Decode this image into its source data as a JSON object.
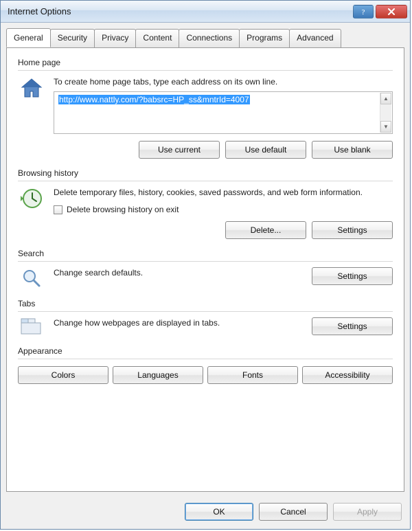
{
  "window": {
    "title": "Internet Options"
  },
  "tabs": [
    "General",
    "Security",
    "Privacy",
    "Content",
    "Connections",
    "Programs",
    "Advanced"
  ],
  "homepage": {
    "label": "Home page",
    "desc": "To create home page tabs, type each address on its own line.",
    "url": "http://www.nattly.com/?babsrc=HP_ss&mntrId=4007",
    "use_current": "Use current",
    "use_default": "Use default",
    "use_blank": "Use blank"
  },
  "history": {
    "label": "Browsing history",
    "desc": "Delete temporary files, history, cookies, saved passwords, and web form information.",
    "checkbox": "Delete browsing history on exit",
    "delete": "Delete...",
    "settings": "Settings"
  },
  "search": {
    "label": "Search",
    "desc": "Change search defaults.",
    "settings": "Settings"
  },
  "tabs_section": {
    "label": "Tabs",
    "desc": "Change how webpages are displayed in tabs.",
    "settings": "Settings"
  },
  "appearance": {
    "label": "Appearance",
    "colors": "Colors",
    "languages": "Languages",
    "fonts": "Fonts",
    "accessibility": "Accessibility"
  },
  "dialog": {
    "ok": "OK",
    "cancel": "Cancel",
    "apply": "Apply"
  }
}
